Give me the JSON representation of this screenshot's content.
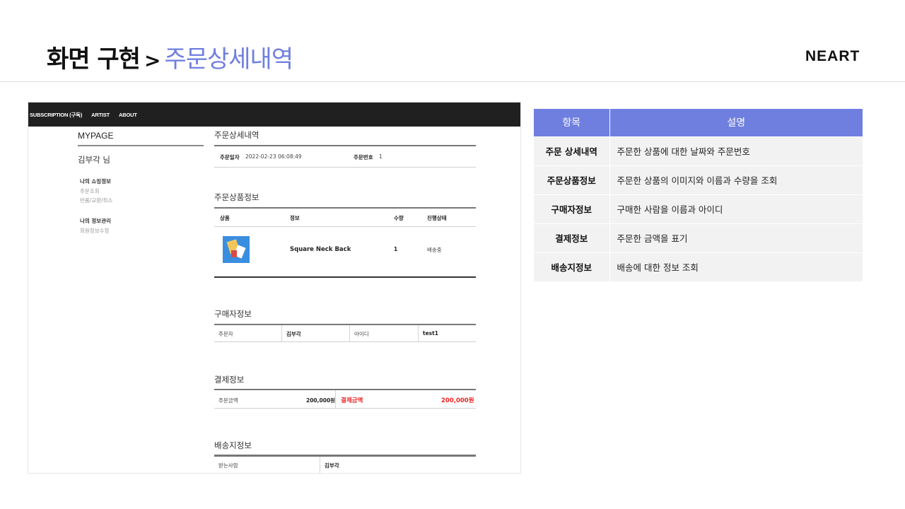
{
  "slide": {
    "title_main": "화면 구현",
    "title_arrow": ">",
    "title_sub": "주문상세내역",
    "brand": "NEART"
  },
  "screenshot": {
    "nav": [
      "SUBSCRIPTION (구독)",
      "ARTIST",
      "ABOUT"
    ],
    "sidebar": {
      "title": "MYPAGE",
      "user": "김부각 님",
      "group1": "나의 쇼핑정보",
      "group1_links": [
        "주문조회",
        "반품/교환/취소"
      ],
      "group2": "나의 정보관리",
      "group2_links": [
        "회원정보수정"
      ]
    },
    "order_detail": {
      "title": "주문상세내역",
      "date_label": "주문일자",
      "date_value": "2022-02-23 06:08:49",
      "order_no_label": "주문번호",
      "order_no_value": "1"
    },
    "order_items": {
      "title": "주문상품정보",
      "headers": [
        "상품",
        "정보",
        "수량",
        "진행상태"
      ],
      "rows": [
        {
          "name": "Square Neck Back",
          "qty": "1",
          "status": "배송중"
        }
      ]
    },
    "buyer": {
      "title": "구매자정보",
      "name_label": "주문자",
      "name_value": "김부각",
      "id_label": "아이디",
      "id_value": "test1"
    },
    "payment": {
      "title": "결제정보",
      "amount_label": "주문금액",
      "amount_value": "200,000원",
      "paid_label": "결제금액",
      "paid_value": "200,000원"
    },
    "shipping": {
      "title": "배송지정보",
      "recipient_label": "받는사람",
      "recipient_value": "김부각"
    }
  },
  "desc_table": {
    "headers": [
      "항목",
      "설명"
    ],
    "rows": [
      {
        "item": "주문 상세내역",
        "desc": "주문한 상품에 대한 날짜와 주문번호"
      },
      {
        "item": "주문상품정보",
        "desc": "주문한 상품의 이미지와 이름과 수량을 조회"
      },
      {
        "item": "구매자정보",
        "desc": "구매한 사람을 이름과 아이디"
      },
      {
        "item": "결제정보",
        "desc": "주문한 금액을 표기"
      },
      {
        "item": "배송지정보",
        "desc": "배송에 대한 정보 조회"
      }
    ]
  },
  "colors": {
    "accent": "#6f7fe0",
    "nav_bg": "#202020",
    "price_red": "#e22222"
  }
}
